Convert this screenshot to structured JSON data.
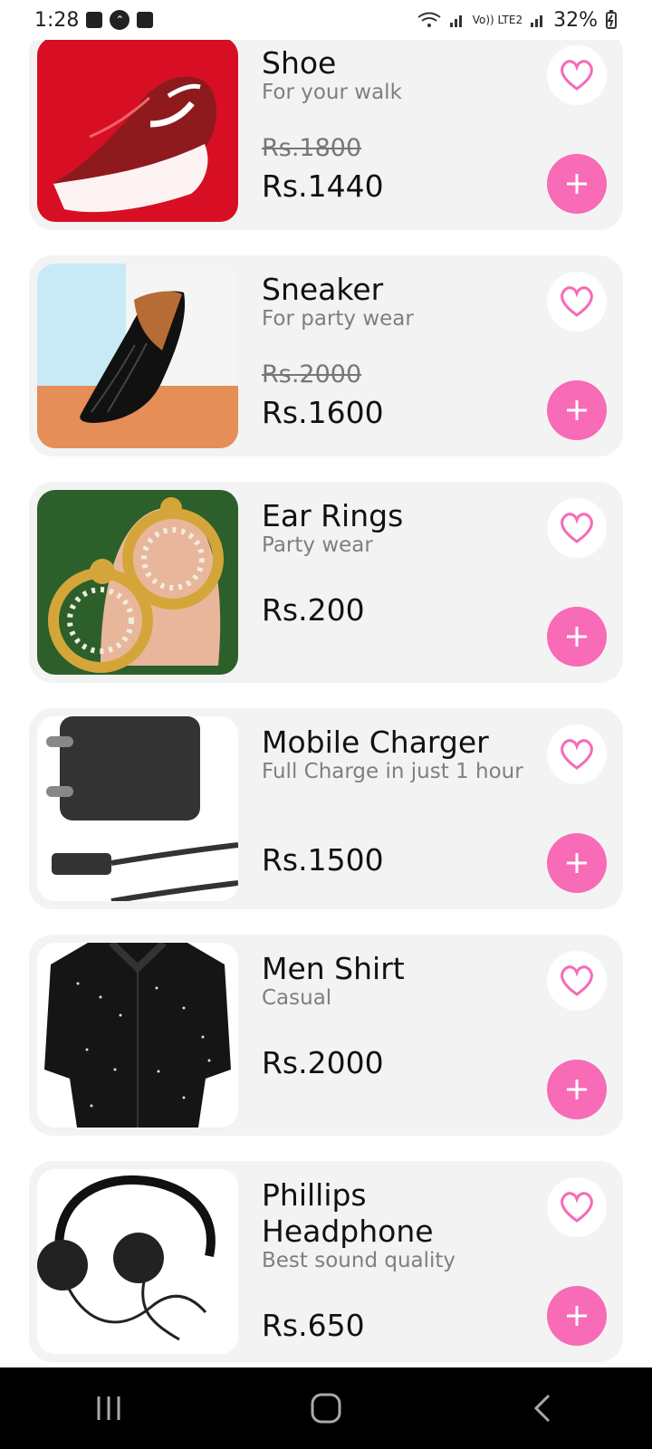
{
  "status_bar": {
    "time": "1:28",
    "battery": "32%",
    "network_label": "Vo))\nLTE2",
    "icons": [
      "gallery-icon",
      "assistant-icon",
      "clock-icon",
      "wifi-icon",
      "signal-icon",
      "battery-icon"
    ]
  },
  "products": [
    {
      "title": "Shoe",
      "subtitle": "For your walk",
      "old_price": "Rs.1800",
      "price": "Rs.1440",
      "image": "red-running-shoe"
    },
    {
      "title": "Sneaker",
      "subtitle": "For party wear",
      "old_price": "Rs.2000",
      "price": "Rs.1600",
      "image": "black-loafer"
    },
    {
      "title": "Ear Rings",
      "subtitle": "Party wear",
      "old_price": "",
      "price": "Rs.200",
      "image": "gold-earrings"
    },
    {
      "title": "Mobile Charger",
      "subtitle": "Full Charge in just 1 hour",
      "old_price": "",
      "price": "Rs.1500",
      "image": "charger"
    },
    {
      "title": "Men Shirt",
      "subtitle": "Casual",
      "old_price": "",
      "price": "Rs.2000",
      "image": "black-shirt"
    },
    {
      "title": "Phillips Headphone",
      "subtitle": "Best sound quality",
      "old_price": "",
      "price": "Rs.650",
      "image": "headphones"
    }
  ],
  "buttons": {
    "wishlist_icon": "heart-outline-icon",
    "add_icon": "plus-icon"
  },
  "colors": {
    "accent_pink": "#f76bb7",
    "card_background": "#f3f3f3",
    "nav_background": "#000000"
  },
  "navigation": {
    "items": [
      "recent-apps-icon",
      "home-icon",
      "back-icon"
    ]
  }
}
